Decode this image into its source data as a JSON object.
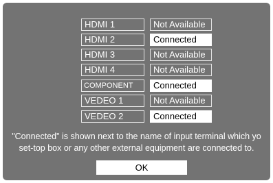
{
  "inputs": [
    {
      "name": "HDMI 1",
      "status": "Not Available"
    },
    {
      "name": "HDMI 2",
      "status": "Connected"
    },
    {
      "name": "HDMI 3",
      "status": "Not Available"
    },
    {
      "name": "HDMI 4",
      "status": "Not Available"
    },
    {
      "name": "COMPONENT",
      "status": "Connected"
    },
    {
      "name": "VEDEO 1",
      "status": "Not Available"
    },
    {
      "name": "VEDEO 2",
      "status": "Connected"
    }
  ],
  "note": {
    "line1": "\"Connected\" is shown next to the name of input terminal which yo",
    "line2": "set-top box or any other external equipment are connected to."
  },
  "ok_label": "OK",
  "colors": {
    "background": "#737373",
    "highlight": "#ffffff"
  }
}
